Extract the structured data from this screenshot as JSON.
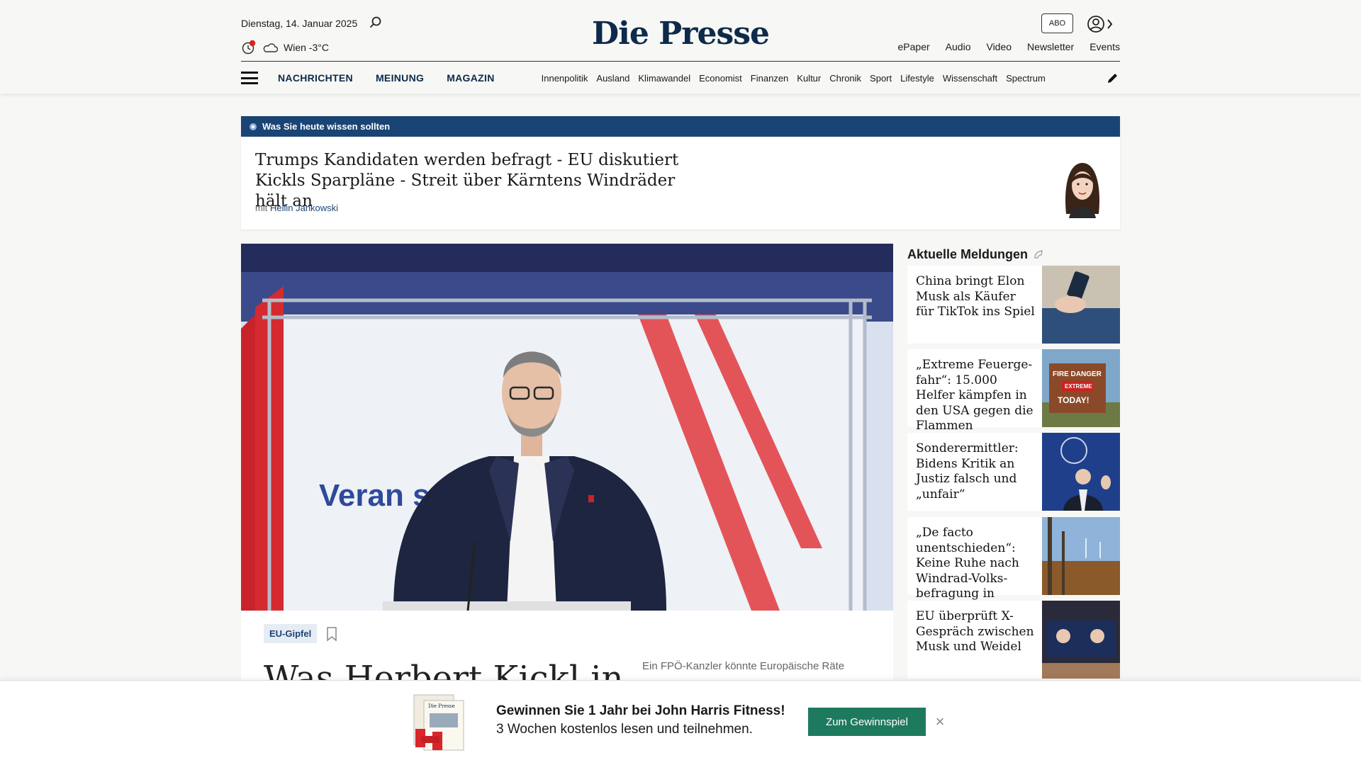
{
  "header": {
    "date": "Dienstag, 14. Januar 2025",
    "weather": "Wien -3°C",
    "logo": "Die Presse",
    "abo": "ABO",
    "toplinks": [
      "ePaper",
      "Audio",
      "Video",
      "Newsletter",
      "Events"
    ],
    "mainnav": [
      "NACHRICHTEN",
      "MEINUNG",
      "MAGAZIN"
    ],
    "subnav": [
      "Innenpolitik",
      "Ausland",
      "Klimawandel",
      "Economist",
      "Finanzen",
      "Kultur",
      "Chronik",
      "Sport",
      "Lifestyle",
      "Wissenschaft",
      "Spectrum"
    ]
  },
  "briefing": {
    "label": "Was Sie heute wissen sollten",
    "title": "Trumps Kandidaten werden befragt - EU diskutiert Kickls Sparpläne - Streit über Kärntens Windräder hält an",
    "meta_prefix": "mit",
    "author": "Hellin Jankowski"
  },
  "hero": {
    "tag": "EU-Gipfel",
    "title": "Was Herbert Kickl in",
    "teaser": "Ein FPÖ-Kanzler könnte Europäische Räte",
    "backdrop_text": "Veran          sterreich"
  },
  "sidebar": {
    "title": "Aktuelle Meldungen",
    "items": [
      {
        "title": "China bringt Elon Musk als Käufer für TikTok ins Spiel"
      },
      {
        "title": "„Extreme Feuerge­fahr“: 15.000 Helfer kämpfen in den USA gegen die Flammen"
      },
      {
        "title": "Sonderermittler: Bidens Kritik an Justiz falsch und „unfair“"
      },
      {
        "title": "„De facto unentschie­den“: Keine Ruhe nach Windrad-Volks­befragung in Kärnten"
      },
      {
        "title": "EU überprüft X-Gespräch zwischen Musk und Weidel"
      }
    ]
  },
  "promo": {
    "headline": "Gewinnen Sie 1 Jahr bei John Harris Fitness!",
    "subline": "3 Wochen kostenlos lesen und teilnehmen.",
    "button": "Zum Gewinnspiel",
    "close": "×"
  },
  "colors": {
    "brand_blue": "#1a4474",
    "promo_green": "#1e7a5f",
    "weather_alert": "#e0201b"
  }
}
